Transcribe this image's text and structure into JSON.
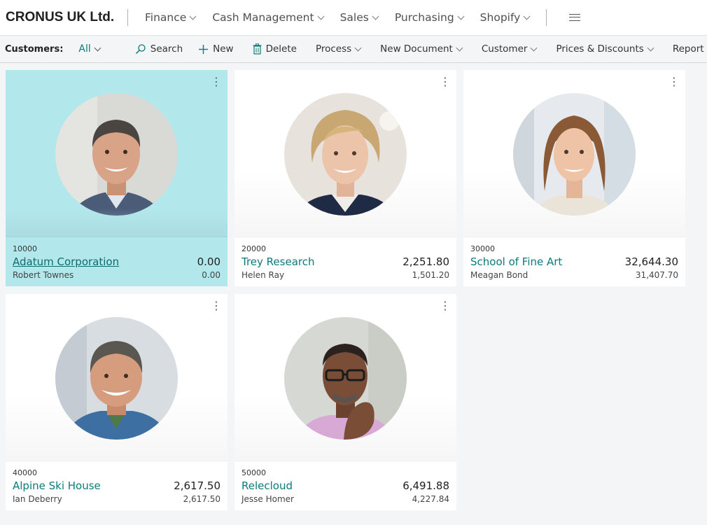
{
  "header": {
    "company": "CRONUS UK Ltd.",
    "menus": [
      "Finance",
      "Cash Management",
      "Sales",
      "Purchasing",
      "Shopify"
    ]
  },
  "actionbar": {
    "caption": "Customers:",
    "filter": "All",
    "search": "Search",
    "new": "New",
    "delete": "Delete",
    "process": "Process",
    "new_document": "New Document",
    "customer": "Customer",
    "prices_discounts": "Prices & Discounts",
    "report": "Report"
  },
  "customers": [
    {
      "no": "10000",
      "name": "Adatum Corporation",
      "balance": "0.00",
      "contact": "Robert Townes",
      "balance_due": "0.00",
      "selected": true
    },
    {
      "no": "20000",
      "name": "Trey Research",
      "balance": "2,251.80",
      "contact": "Helen Ray",
      "balance_due": "1,501.20"
    },
    {
      "no": "30000",
      "name": "School of Fine Art",
      "balance": "32,644.30",
      "contact": "Meagan Bond",
      "balance_due": "31,407.70"
    },
    {
      "no": "40000",
      "name": "Alpine Ski House",
      "balance": "2,617.50",
      "contact": "Ian Deberry",
      "balance_due": "2,617.50"
    },
    {
      "no": "50000",
      "name": "Relecloud",
      "balance": "6,491.88",
      "contact": "Jesse Homer",
      "balance_due": "4,227.84"
    }
  ],
  "colors": {
    "accent": "#0b7a7a",
    "selected_tile": "#b2e7ec",
    "page_background": "#f4f5f6"
  }
}
